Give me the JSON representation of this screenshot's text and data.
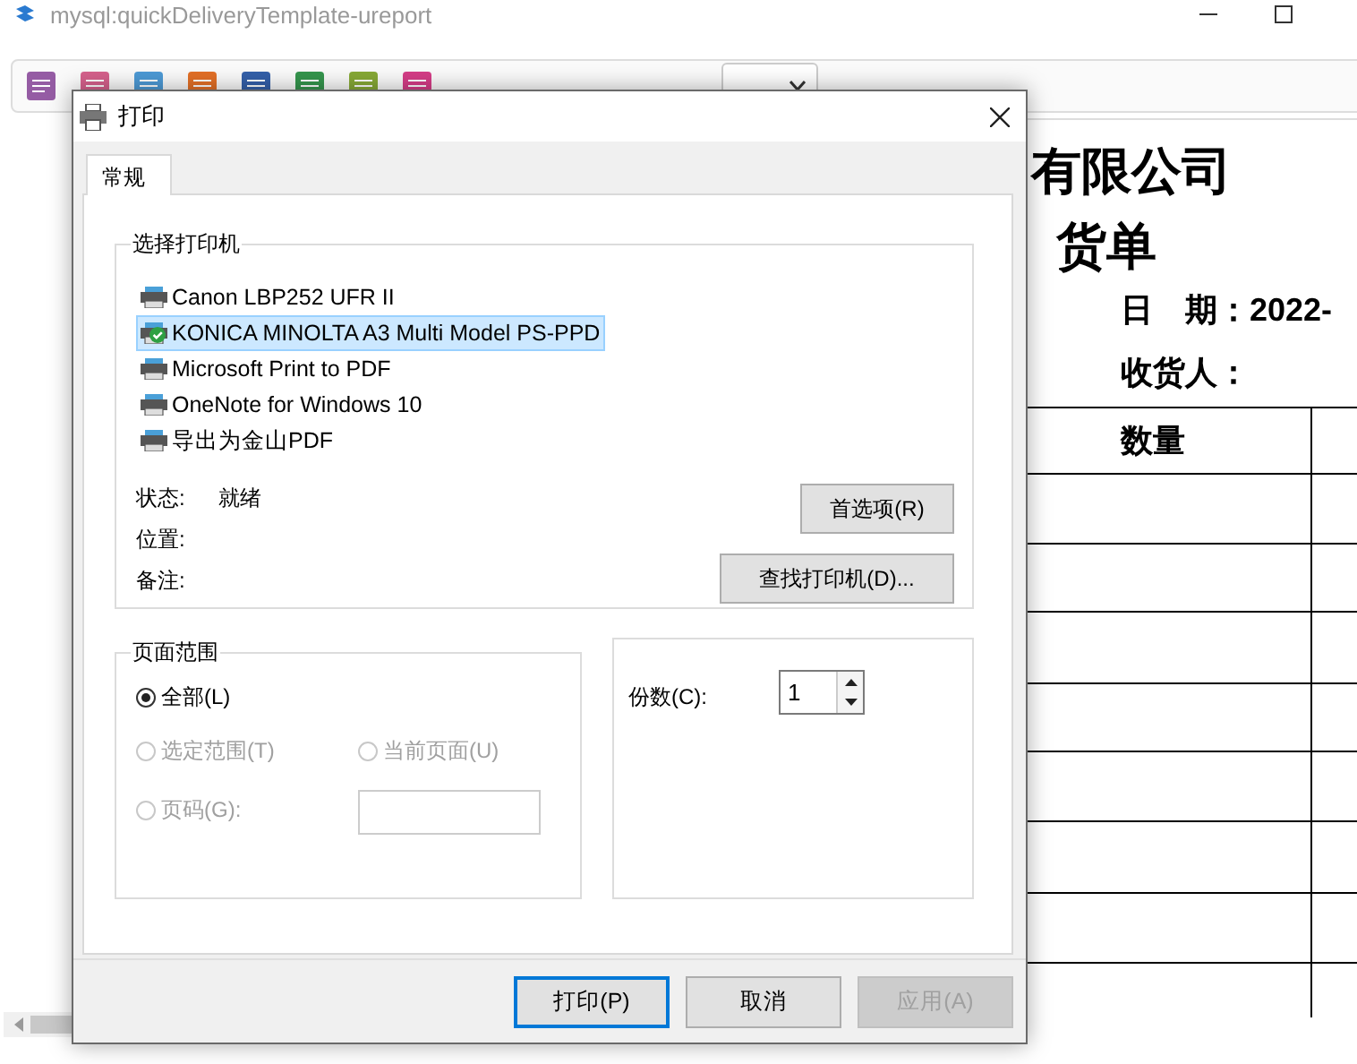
{
  "window": {
    "title": "mysql:quickDeliveryTemplate-ureport"
  },
  "report": {
    "company": "有限公司",
    "doc_title": "货单",
    "date_label": "日　期：",
    "date_value": "2022-",
    "consignee_label": "收货人：",
    "column_header": "数量"
  },
  "dialog": {
    "title": "打印",
    "tabs": [
      {
        "label": "常规",
        "selected": true
      }
    ],
    "printer_group": {
      "title": "选择打印机",
      "printers": [
        {
          "name": "Canon LBP252 UFR II",
          "selected": false,
          "default": false
        },
        {
          "name": "KONICA MINOLTA A3 Multi Model PS-PPD",
          "selected": true,
          "default": true
        },
        {
          "name": "Microsoft Print to PDF",
          "selected": false,
          "default": false
        },
        {
          "name": "OneNote for Windows 10",
          "selected": false,
          "default": false
        },
        {
          "name": "导出为金山PDF",
          "selected": false,
          "default": false
        }
      ],
      "status_label": "状态:",
      "status_value": "就绪",
      "location_label": "位置:",
      "comment_label": "备注:",
      "preferences_button": "首选项(R)",
      "find_button": "查找打印机(D)..."
    },
    "page_range": {
      "title": "页面范围",
      "options": [
        {
          "label": "全部(L)",
          "selected": true,
          "disabled": false
        },
        {
          "label": "选定范围(T)",
          "selected": false,
          "disabled": true
        },
        {
          "label": "当前页面(U)",
          "selected": false,
          "disabled": true
        },
        {
          "label": "页码(G):",
          "selected": false,
          "disabled": true
        }
      ],
      "pages_field_disabled": true
    },
    "copies": {
      "label": "份数(C):",
      "value": "1"
    },
    "buttons": [
      {
        "label": "打印(P)",
        "default": true,
        "disabled": false
      },
      {
        "label": "取消",
        "default": false,
        "disabled": false
      },
      {
        "label": "应用(A)",
        "default": false,
        "disabled": true
      }
    ]
  }
}
